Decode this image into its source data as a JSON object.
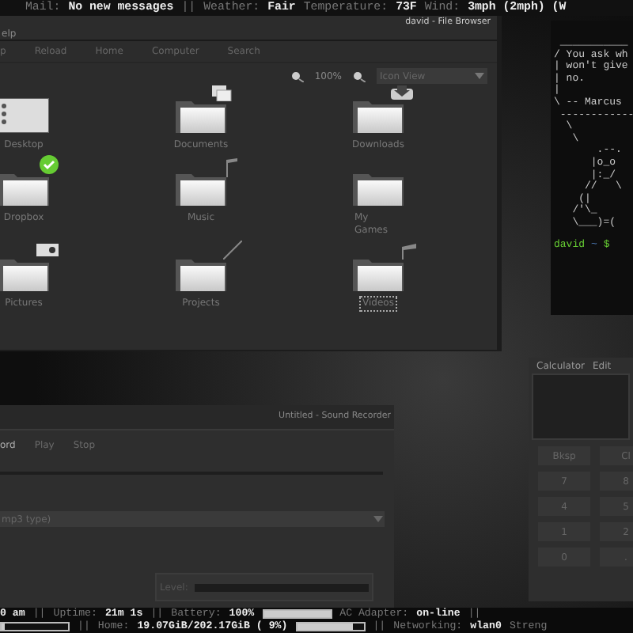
{
  "top_bar": [
    {
      "kind": "key",
      "text": "Mail:"
    },
    {
      "kind": "value",
      "text": "No new messages"
    },
    {
      "kind": "key",
      "text": "||"
    },
    {
      "kind": "key",
      "text": "Weather:"
    },
    {
      "kind": "value",
      "text": "Fair"
    },
    {
      "kind": "key",
      "text": "Temperature:"
    },
    {
      "kind": "value",
      "text": "73F"
    },
    {
      "kind": "key",
      "text": "Wind:"
    },
    {
      "kind": "value",
      "text": "3mph (2mph) (W"
    }
  ],
  "file_browser": {
    "title": "david - File Browser",
    "menu": [
      "elp"
    ],
    "toolbar": [
      "p",
      "Reload",
      "Home",
      "Computer",
      "Search"
    ],
    "zoom": "100%",
    "view": "Icon View",
    "items": [
      {
        "name": "Desktop",
        "kind": "desktop",
        "selected": false
      },
      {
        "name": "Documents",
        "kind": "documents",
        "selected": false
      },
      {
        "name": "Downloads",
        "kind": "downloads",
        "selected": false
      },
      {
        "name": "Dropbox",
        "kind": "dropbox",
        "selected": false
      },
      {
        "name": "Music",
        "kind": "music",
        "selected": false
      },
      {
        "name": "My Games",
        "kind": "plain",
        "selected": false
      },
      {
        "name": "Pictures",
        "kind": "pictures",
        "selected": false
      },
      {
        "name": "Projects",
        "kind": "projects",
        "selected": false
      },
      {
        "name": "Videos",
        "kind": "videos",
        "selected": true
      }
    ]
  },
  "terminal": {
    "lines": [
      " ___________",
      "/ You ask wh",
      "| won't give",
      "| no.",
      "|",
      "\\ -- Marcus",
      " ------------",
      "  \\",
      "   \\",
      "       .--.",
      "      |o_o",
      "      |:_/",
      "     //   \\",
      "    (|",
      "   /'\\_",
      "   \\___)=("
    ],
    "prompt": {
      "user": "david",
      "cwd": "~",
      "symbol": "$"
    }
  },
  "calculator": {
    "menu": [
      "Calculator",
      "Edit"
    ],
    "buttons": [
      "Bksp",
      "Cl",
      "7",
      "8",
      "4",
      "5",
      "1",
      "2",
      "0",
      "."
    ]
  },
  "sound_recorder": {
    "title": "Untitled - Sound Recorder",
    "toolbar": [
      {
        "label": "ord",
        "disabled": false
      },
      {
        "label": "Play",
        "disabled": true
      },
      {
        "label": "Stop",
        "disabled": true
      }
    ],
    "format": "mp3 type)",
    "level_label": "Level:",
    "level": 0
  },
  "bottom_bar": [
    [
      {
        "kind": "value",
        "text": "0 am"
      },
      {
        "kind": "key",
        "text": "||"
      },
      {
        "kind": "key",
        "text": "Uptime:"
      },
      {
        "kind": "value",
        "text": "21m 1s"
      },
      {
        "kind": "key",
        "text": "||"
      },
      {
        "kind": "key",
        "text": "Battery:"
      },
      {
        "kind": "value",
        "text": "100%"
      },
      {
        "kind": "bar",
        "level": 1
      },
      {
        "kind": "key",
        "text": "AC Adapter:"
      },
      {
        "kind": "value",
        "text": "on-line"
      },
      {
        "kind": "key",
        "text": "||"
      }
    ],
    [
      {
        "kind": "bar",
        "level": 0.05
      },
      {
        "kind": "key",
        "text": "||"
      },
      {
        "kind": "key",
        "text": "Home:"
      },
      {
        "kind": "value",
        "text": "19.07GiB/202.17GiB ( 9%)"
      },
      {
        "kind": "bar",
        "level": 0.85
      },
      {
        "kind": "key",
        "text": "||"
      },
      {
        "kind": "key",
        "text": "Networking:"
      },
      {
        "kind": "value",
        "text": "wlan0"
      },
      {
        "kind": "key",
        "text": "Streng"
      }
    ]
  ]
}
